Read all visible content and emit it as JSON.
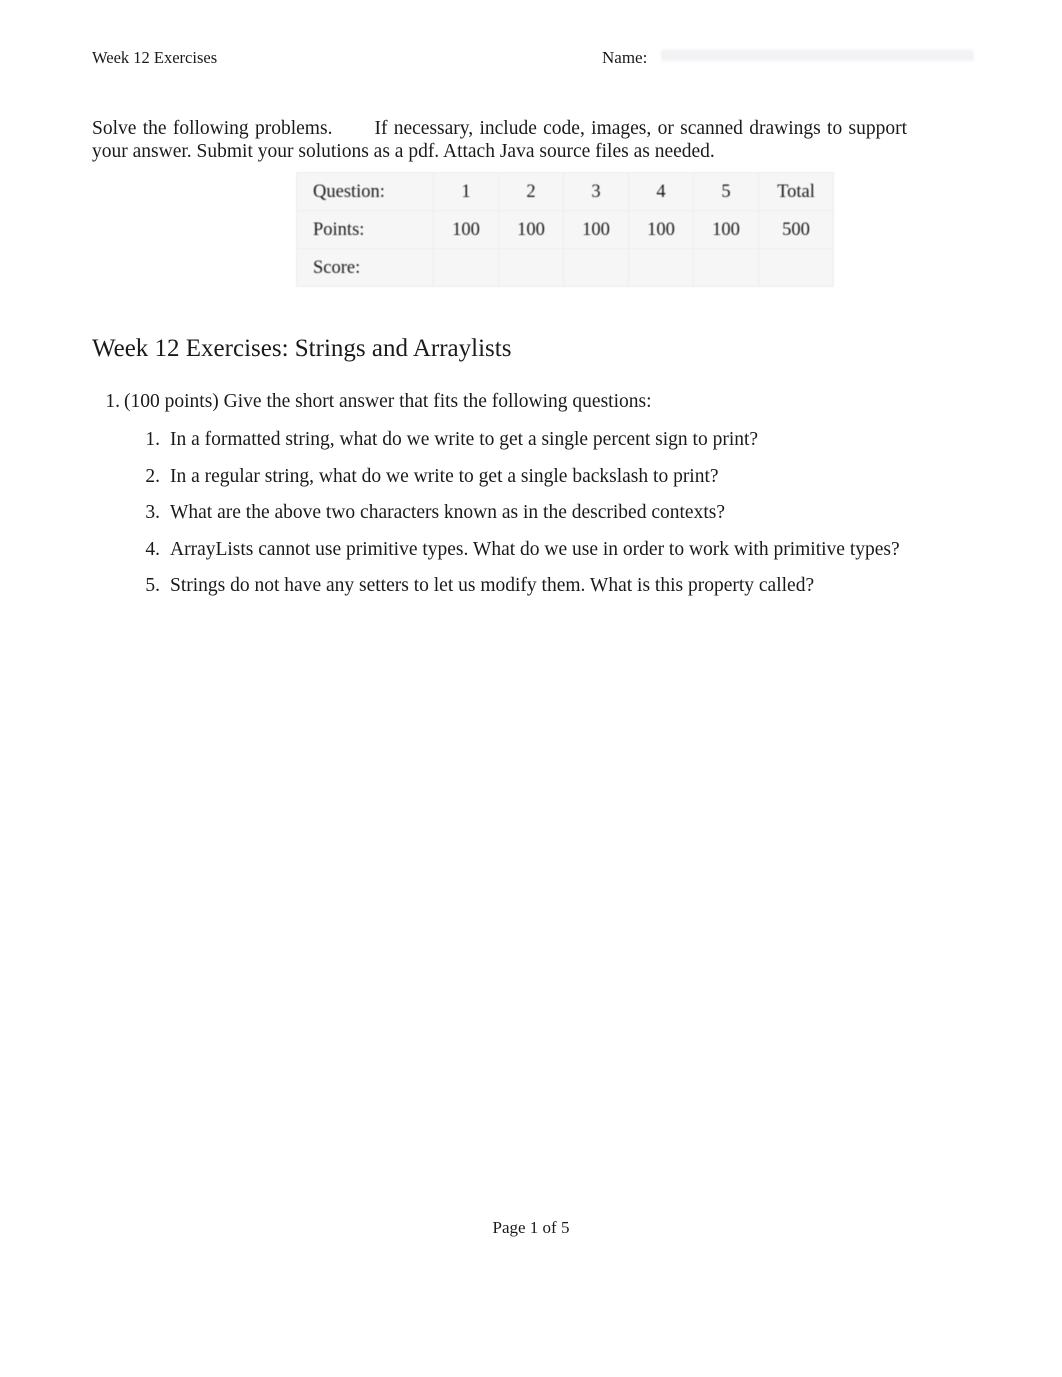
{
  "document": {
    "header": {
      "title": "Week 12 Exercises",
      "name_label": "Name:",
      "name_value": ""
    },
    "intro": {
      "part1": "Solve the following problems.",
      "part2": "If necessary, include code, images, or scanned drawings to support your answer. Submit your solutions as a pdf. Attach Java source files as needed."
    },
    "points_table": {
      "row_labels": [
        "Question:",
        "Points:",
        "Score:"
      ],
      "questions": [
        "1",
        "2",
        "3",
        "4",
        "5"
      ],
      "total_header": "Total",
      "points": [
        "100",
        "100",
        "100",
        "100",
        "100"
      ],
      "points_total": "500",
      "scores": [
        "",
        "",
        "",
        "",
        ""
      ],
      "score_total": "",
      "background_color": "#f6f6f7",
      "border_color": "#ededee"
    },
    "section_heading": "Week 12 Exercises: Strings and Arraylists",
    "problems": [
      {
        "number": "1.",
        "text": "(100 points) Give the short answer that fits the following questions:",
        "subquestions": [
          {
            "number": "1.",
            "text": "In a formatted string, what do we write to get a single percent sign to print?"
          },
          {
            "number": "2.",
            "text": "In a regular string, what do we write to get a single backslash to print?"
          },
          {
            "number": "3.",
            "text": "What are the above two characters known as in the described contexts?"
          },
          {
            "number": "4.",
            "text": "ArrayLists cannot use primitive types. What do we use in order to work with primitive types?"
          },
          {
            "number": "5.",
            "text": "Strings do not have any setters to let us modify them. What is this property called?"
          }
        ]
      }
    ],
    "footer": {
      "page_label": "Page 1 of 5"
    }
  }
}
